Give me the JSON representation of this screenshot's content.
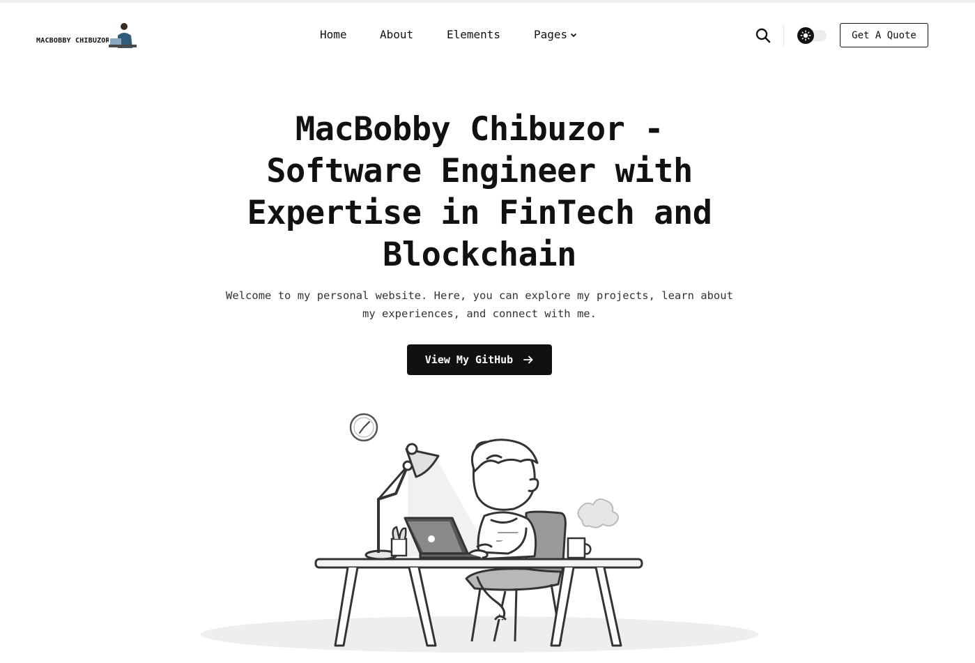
{
  "header": {
    "logo_text": "MACBOBBY CHIBUZOR",
    "logo_icon": "avatar-with-laptop",
    "nav": [
      {
        "label": "Home"
      },
      {
        "label": "About"
      },
      {
        "label": "Elements"
      },
      {
        "label": "Pages",
        "has_dropdown": true
      }
    ],
    "search_icon": "search-icon",
    "theme_toggle_icon": "sun-icon",
    "quote_label": "Get A Quote"
  },
  "hero": {
    "title": "MacBobby Chibuzor - Software Engineer with Expertise in FinTech and Blockchain",
    "subtitle": "Welcome to my personal website. Here, you can explore my projects, learn about my experiences, and connect with me.",
    "cta_label": "View My GitHub",
    "cta_icon": "arrow-right-icon",
    "illustration": "developer-at-desk-illustration"
  },
  "colors": {
    "text": "#111111",
    "button_bg": "#111111",
    "button_text": "#ffffff",
    "background": "#ffffff"
  }
}
